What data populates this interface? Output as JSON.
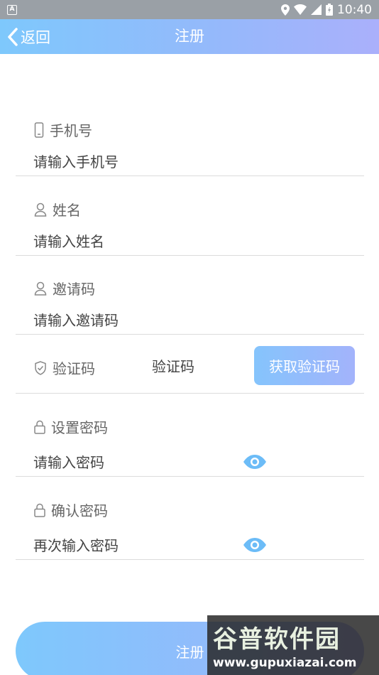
{
  "status_bar": {
    "notification_glyph": "A",
    "time": "10:40"
  },
  "header": {
    "back_label": "返回",
    "title": "注册"
  },
  "fields": {
    "phone": {
      "label": "手机号",
      "placeholder": "请输入手机号",
      "icon": "phone-icon"
    },
    "name": {
      "label": "姓名",
      "placeholder": "请输入姓名",
      "icon": "user-icon"
    },
    "invite": {
      "label": "邀请码",
      "placeholder": "请输入邀请码",
      "icon": "user-icon"
    },
    "code": {
      "label": "验证码",
      "placeholder": "验证码",
      "button": "获取验证码",
      "icon": "shield-icon"
    },
    "password": {
      "label": "设置密码",
      "placeholder": "请输入密码",
      "icon": "lock-icon"
    },
    "confirm": {
      "label": "确认密码",
      "placeholder": "再次输入密码",
      "icon": "lock-icon"
    }
  },
  "register_button": "注册",
  "watermark": {
    "title": "谷普软件园",
    "url": "www.gupuxiazai.com"
  },
  "colors": {
    "accent_start": "#7ec8fc",
    "accent_end": "#aab0fb",
    "eye_icon": "#6cbcf7"
  }
}
